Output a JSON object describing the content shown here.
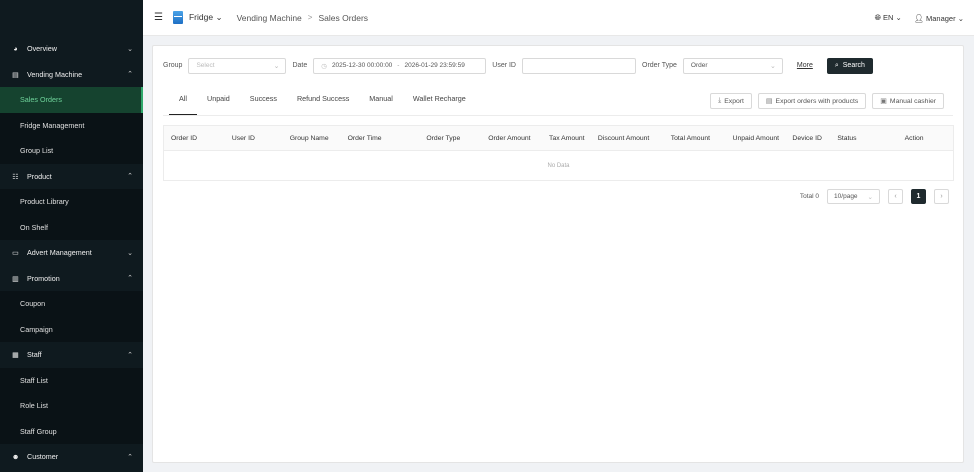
{
  "header": {
    "store": "Fridge",
    "breadcrumb": [
      "Vending Machine",
      "Sales Orders"
    ],
    "breadcrumb_sep": ">",
    "language": "EN",
    "user": "Manager"
  },
  "sidebar": {
    "items": [
      {
        "label": "Overview",
        "type": "section",
        "chevron": "v",
        "icon": "dashboard-icon"
      },
      {
        "label": "Vending Machine",
        "type": "section",
        "chevron": "^",
        "icon": "machine-icon"
      },
      {
        "label": "Sales Orders",
        "type": "sub",
        "active": true
      },
      {
        "label": "Fridge Management",
        "type": "sub"
      },
      {
        "label": "Group List",
        "type": "sub"
      },
      {
        "label": "Product",
        "type": "section",
        "chevron": "^",
        "icon": "product-icon"
      },
      {
        "label": "Product Library",
        "type": "sub"
      },
      {
        "label": "On Shelf",
        "type": "sub"
      },
      {
        "label": "Advert Management",
        "type": "section",
        "chevron": "v",
        "icon": "advert-icon"
      },
      {
        "label": "Promotion",
        "type": "section",
        "chevron": "^",
        "icon": "promotion-icon"
      },
      {
        "label": "Coupon",
        "type": "sub"
      },
      {
        "label": "Campaign",
        "type": "sub"
      },
      {
        "label": "Staff",
        "type": "section",
        "chevron": "^",
        "icon": "staff-icon"
      },
      {
        "label": "Staff List",
        "type": "sub"
      },
      {
        "label": "Role List",
        "type": "sub"
      },
      {
        "label": "Staff Group",
        "type": "sub"
      },
      {
        "label": "Customer",
        "type": "section",
        "chevron": "^",
        "icon": "customer-icon"
      }
    ]
  },
  "filters": {
    "group_label": "Group",
    "group_placeholder": "Select",
    "date_label": "Date",
    "date_start": "2025-12-30 00:00:00",
    "date_sep": "-",
    "date_end": "2026-01-29 23:59:59",
    "userid_label": "User ID",
    "userid_value": "",
    "ordertype_label": "Order Type",
    "ordertype_value": "Order",
    "more_label": "More",
    "search_label": "Search"
  },
  "tabs": [
    "All",
    "Unpaid",
    "Success",
    "Refund Success",
    "Manual",
    "Wallet Recharge"
  ],
  "actions": {
    "export": "Export",
    "export_products": "Export orders with products",
    "manual_cashier": "Manual cashier"
  },
  "table": {
    "columns": [
      "Order ID",
      "User ID",
      "Group Name",
      "Order Time",
      "Order Type",
      "Order Amount",
      "Tax Amount",
      "Discount Amount",
      "Total Amount",
      "Unpaid Amount",
      "Device ID",
      "Status",
      "Action"
    ],
    "empty_text": "No Data"
  },
  "pagination": {
    "total": "Total 0",
    "page_size": "10/page",
    "current_page": "1"
  },
  "colors": {
    "sidebar_bg": "#0f1a1f",
    "active_item_bg": "#15432f",
    "active_item_text": "#6fd49b",
    "primary_button": "#1f2a2e"
  }
}
